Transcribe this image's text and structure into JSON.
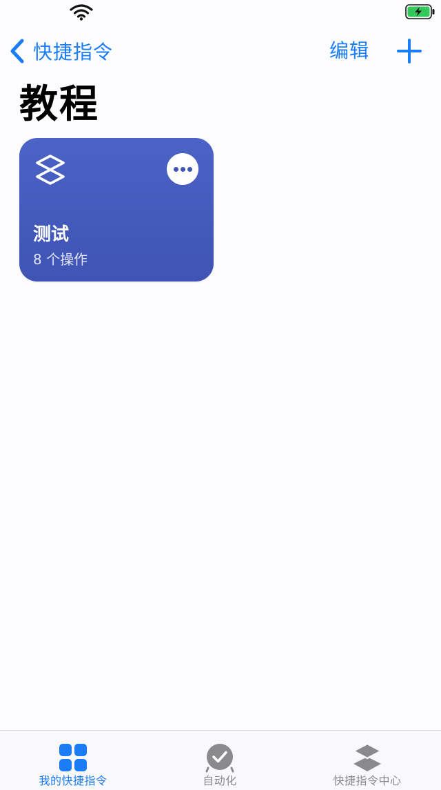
{
  "nav": {
    "back_label": "快捷指令",
    "edit_label": "编辑"
  },
  "page": {
    "title": "教程"
  },
  "shortcuts": [
    {
      "title": "测试",
      "subtitle": "8 个操作",
      "icon": "layers-icon"
    }
  ],
  "tabs": [
    {
      "label": "我的快捷指令",
      "icon": "grid-icon",
      "active": true
    },
    {
      "label": "自动化",
      "icon": "clock-check-icon",
      "active": false
    },
    {
      "label": "快捷指令中心",
      "icon": "layers-icon",
      "active": false
    }
  ],
  "colors": {
    "accent": "#1a7df5",
    "card": "#4759bd",
    "tab_inactive": "#8a8a8e",
    "battery_fill": "#34c759"
  }
}
